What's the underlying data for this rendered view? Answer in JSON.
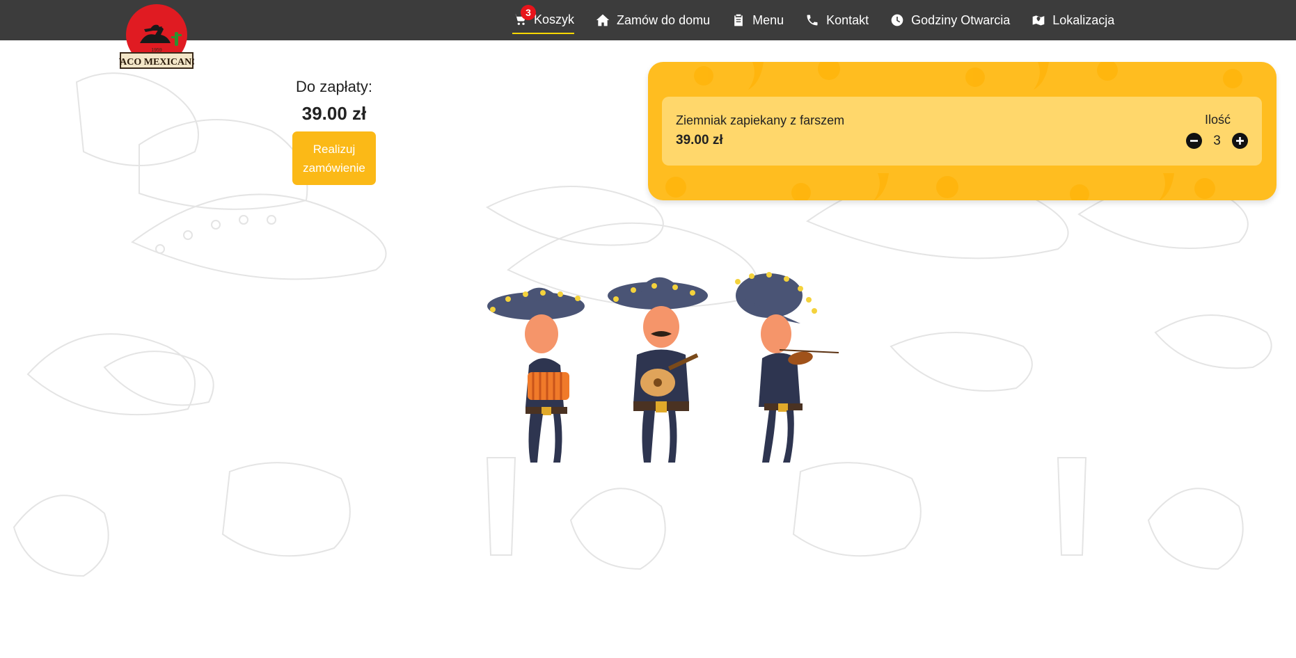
{
  "brand": {
    "logo_text": "TACO MEXICANO",
    "logo_year": "1959",
    "colors": {
      "nav_bg": "#3c3c3c",
      "accent": "#fbb917",
      "panel": "#ffbd20",
      "badge": "#e8141b",
      "active_underline": "#ffd800"
    }
  },
  "nav": {
    "items": [
      {
        "label": "Koszyk",
        "icon": "cart-icon",
        "badge": "3",
        "active": true
      },
      {
        "label": "Zamów do domu",
        "icon": "home-icon"
      },
      {
        "label": "Menu",
        "icon": "clipboard-icon"
      },
      {
        "label": "Kontakt",
        "icon": "phone-icon"
      },
      {
        "label": "Godziny Otwarcia",
        "icon": "clock-icon"
      },
      {
        "label": "Lokalizacja",
        "icon": "map-marker-icon"
      }
    ]
  },
  "summary": {
    "label": "Do zapłaty:",
    "total": "39.00 zł",
    "order_button": "Realizuj zamówienie"
  },
  "cart": {
    "items": [
      {
        "name": "Ziemniak zapiekany z farszem",
        "price": "39.00 zł",
        "quantity_label": "Ilość",
        "quantity": "3",
        "minus_icon": "minus-circle-icon",
        "plus_icon": "plus-circle-icon"
      }
    ]
  }
}
